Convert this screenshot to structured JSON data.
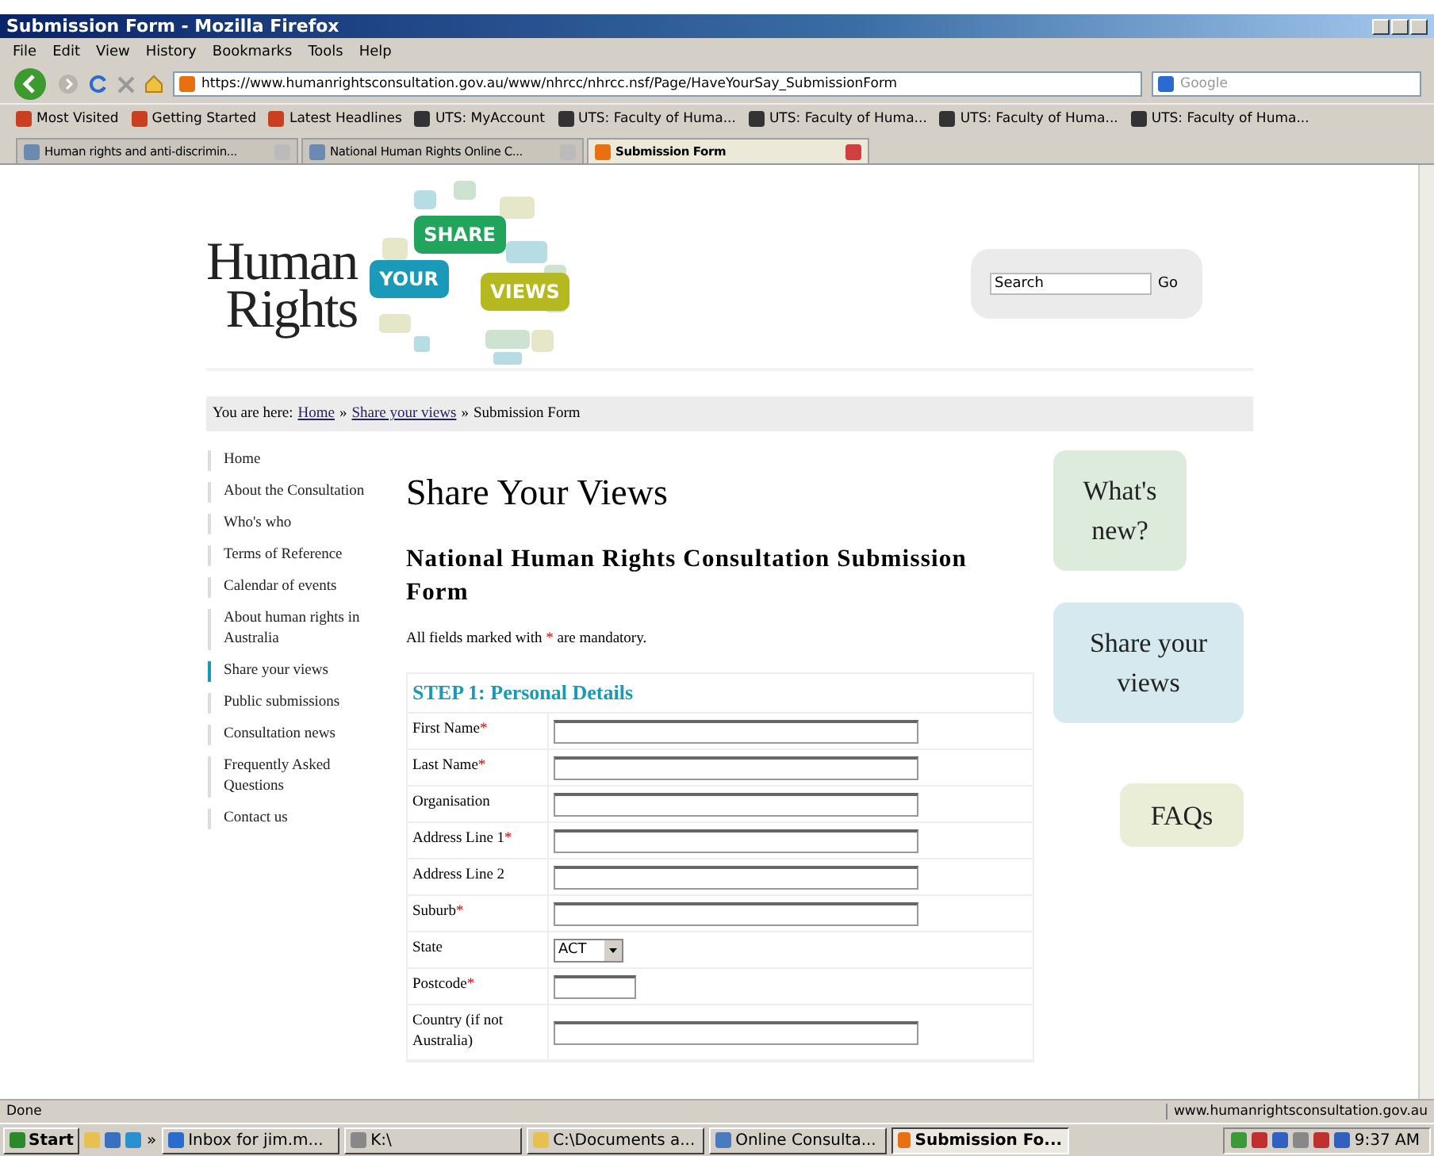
{
  "window": {
    "title": "Submission Form - Mozilla Firefox"
  },
  "menu": [
    "File",
    "Edit",
    "View",
    "History",
    "Bookmarks",
    "Tools",
    "Help"
  ],
  "nav": {
    "url": "https://www.humanrightsconsultation.gov.au/www/nhrcc/nhrcc.nsf/Page/HaveYourSay_SubmissionForm",
    "search_placeholder": "Google"
  },
  "bookmarks": [
    "Most Visited",
    "Getting Started",
    "Latest Headlines",
    "UTS: MyAccount",
    "UTS: Faculty of Huma...",
    "UTS: Faculty of Huma...",
    "UTS: Faculty of Huma...",
    "UTS: Faculty of Huma..."
  ],
  "tabs": [
    {
      "label": "Human rights and anti-discrimin...",
      "selected": false
    },
    {
      "label": "National Human Rights Online C...",
      "selected": false
    },
    {
      "label": "Submission Form",
      "selected": true
    }
  ],
  "header": {
    "logo_lines": [
      "Human",
      "Rights"
    ],
    "bubbles": [
      "SHARE",
      "YOUR",
      "VIEWS"
    ],
    "search_value": "Search",
    "search_button": "Go"
  },
  "breadcrumb": {
    "label": "You are here:",
    "links": [
      "Home",
      "Share your views"
    ],
    "separator": "»",
    "current": "Submission Form"
  },
  "sidebar": [
    {
      "label": "Home",
      "selected": false
    },
    {
      "label": "About the Consultation",
      "selected": false
    },
    {
      "label": "Who's who",
      "selected": false
    },
    {
      "label": "Terms of Reference",
      "selected": false
    },
    {
      "label": "Calendar of events",
      "selected": false
    },
    {
      "label": "About human rights in Australia",
      "selected": false
    },
    {
      "label": "Share your views",
      "selected": true
    },
    {
      "label": "Public submissions",
      "selected": false
    },
    {
      "label": "Consultation news",
      "selected": false
    },
    {
      "label": "Frequently Asked Questions",
      "selected": false
    },
    {
      "label": "Contact us",
      "selected": false
    }
  ],
  "page_title": "Share Your Views",
  "form": {
    "title": "National Human Rights Consultation Submission Form",
    "note_before": "All fields marked with",
    "required_mark": "*",
    "note_after": "are mandatory.",
    "step": "STEP 1: Personal Details",
    "fields": [
      {
        "label": "First Name",
        "required": true,
        "kind": "text"
      },
      {
        "label": "Last Name",
        "required": true,
        "kind": "text"
      },
      {
        "label": "Organisation",
        "required": false,
        "kind": "text"
      },
      {
        "label": "Address Line 1",
        "required": true,
        "kind": "text"
      },
      {
        "label": "Address Line 2",
        "required": false,
        "kind": "text"
      },
      {
        "label": "Suburb",
        "required": true,
        "kind": "text"
      },
      {
        "label": "State",
        "required": false,
        "kind": "select",
        "value": "ACT"
      },
      {
        "label": "Postcode",
        "required": true,
        "kind": "short"
      },
      {
        "label": "Country (if not Australia)",
        "required": false,
        "kind": "text"
      }
    ]
  },
  "side_bubbles": [
    {
      "label": "What's new?",
      "color": "#dcebdc"
    },
    {
      "label": "Share your views",
      "color": "#d5e9ef"
    },
    {
      "label": "FAQs",
      "color": "#eaeed6"
    }
  ],
  "status_bar": {
    "text": "Done",
    "url": "www.humanrightsconsultation.gov.au"
  },
  "taskbar": {
    "start": "Start",
    "more": "»",
    "tasks": [
      {
        "label": "Inbox for jim.m...",
        "selected": false
      },
      {
        "label": "K:\\",
        "selected": false
      },
      {
        "label": "C:\\Documents a...",
        "selected": false
      },
      {
        "label": "Online Consulta...",
        "selected": false
      },
      {
        "label": "Submission Fo...",
        "selected": true
      }
    ],
    "time": "9:37 AM"
  }
}
